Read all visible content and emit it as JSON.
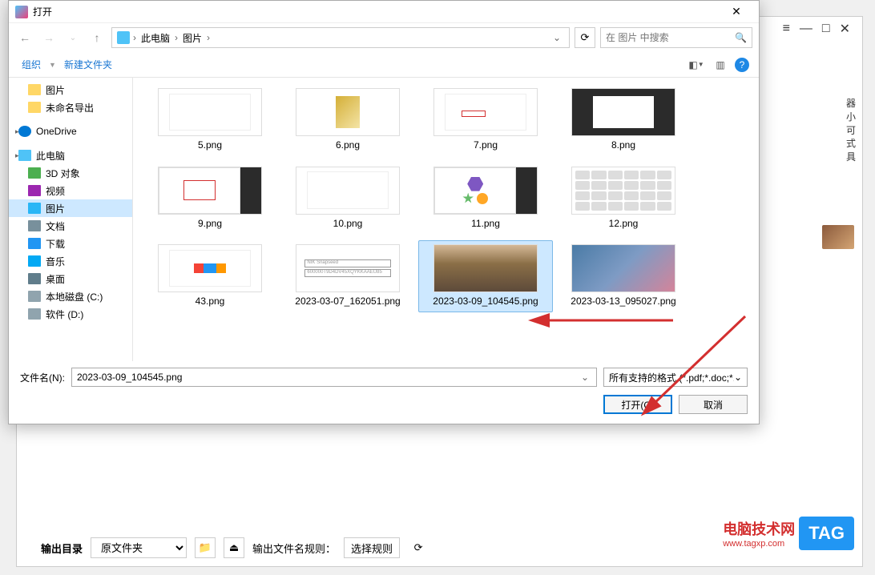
{
  "dialog": {
    "title": "打开",
    "path": {
      "root": "此电脑",
      "current": "图片"
    },
    "search_placeholder": "在 图片 中搜索",
    "toolbar": {
      "organize": "组织",
      "new_folder": "新建文件夹"
    },
    "sidebar": [
      {
        "icon": "folder",
        "label": "图片",
        "indent": 1
      },
      {
        "icon": "folder",
        "label": "未命名导出",
        "indent": 1
      },
      {
        "icon": "onedrive",
        "label": "OneDrive",
        "indent": 0,
        "spaced": true
      },
      {
        "icon": "pc",
        "label": "此电脑",
        "indent": 0,
        "spaced": true
      },
      {
        "icon": "obj3d",
        "label": "3D 对象",
        "indent": 1
      },
      {
        "icon": "video",
        "label": "视频",
        "indent": 1
      },
      {
        "icon": "pics",
        "label": "图片",
        "indent": 1,
        "selected": true
      },
      {
        "icon": "docs",
        "label": "文档",
        "indent": 1
      },
      {
        "icon": "down",
        "label": "下载",
        "indent": 1
      },
      {
        "icon": "music",
        "label": "音乐",
        "indent": 1
      },
      {
        "icon": "desk",
        "label": "桌面",
        "indent": 1
      },
      {
        "icon": "disk",
        "label": "本地磁盘 (C:)",
        "indent": 1
      },
      {
        "icon": "disk",
        "label": "软件 (D:)",
        "indent": 1
      }
    ],
    "files": [
      {
        "name": "5.png",
        "thumb": "paper"
      },
      {
        "name": "6.png",
        "thumb": "gold"
      },
      {
        "name": "7.png",
        "thumb": "redbox"
      },
      {
        "name": "8.png",
        "thumb": "darkeditor"
      },
      {
        "name": "9.png",
        "thumb": "editor"
      },
      {
        "name": "10.png",
        "thumb": "form"
      },
      {
        "name": "11.png",
        "thumb": "shapes"
      },
      {
        "name": "12.png",
        "thumb": "icons"
      },
      {
        "name": "43.png",
        "thumb": "chart"
      },
      {
        "name": "2023-03-07_162051.png",
        "thumb": "textform"
      },
      {
        "name": "2023-03-09_104545.png",
        "thumb": "portrait",
        "selected": true
      },
      {
        "name": "2023-03-13_095027.png",
        "thumb": "anime"
      }
    ],
    "footer": {
      "filename_label": "文件名(N):",
      "filename_value": "2023-03-09_104545.png",
      "filter": "所有支持的格式 (*.pdf;*.doc;*.",
      "open": "打开(O)",
      "cancel": "取消"
    },
    "textform": {
      "row1": "NIK Snapseed",
      "row2": "600000T9D4DV45XQYKKAAEU85"
    }
  },
  "bg": {
    "output_label": "输出目录",
    "folder_select": "原文件夹",
    "rule_label": "输出文件名规则：",
    "rule_btn": "选择规则",
    "side_text": "器\n小\n可\n式\n具",
    "watermark": "电脑技术网",
    "watermark_sub": "www.tagxp.com",
    "tag": "TAG"
  }
}
